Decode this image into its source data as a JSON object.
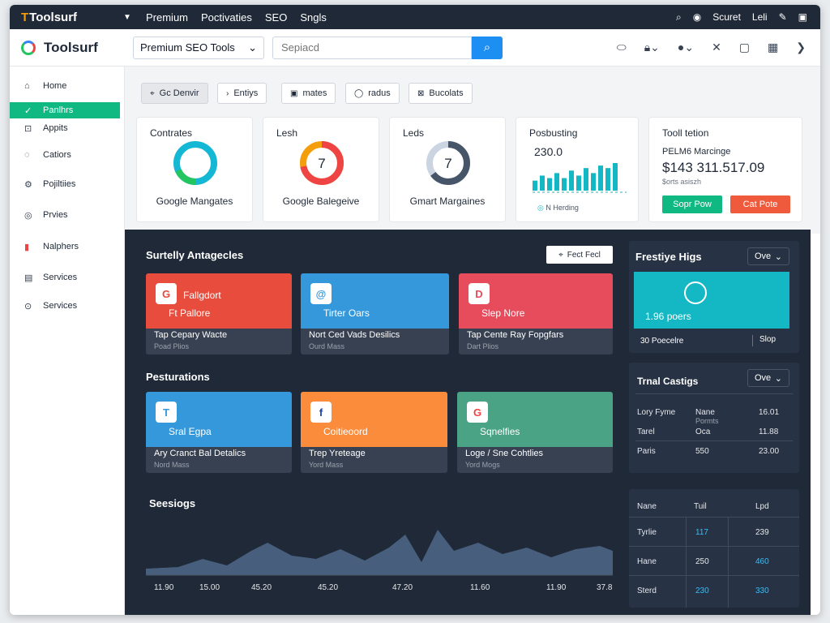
{
  "menubar": {
    "brand": "Toolsurf",
    "items": [
      "Premium",
      "Poctivaties",
      "SEO",
      "Sngls"
    ],
    "right_text": "Scuret",
    "right_text2": "Leli"
  },
  "toolbar": {
    "logo": "Toolsurf",
    "select_value": "Premium SEO Tools",
    "search_placeholder": "Sepiacd"
  },
  "sidebar": {
    "items": [
      {
        "label": "Home",
        "icon": "home-icon"
      },
      {
        "label": "Panlhrs",
        "icon": "check-icon",
        "active": true
      },
      {
        "label": "Appits",
        "icon": "apps-icon"
      },
      {
        "label": "Catiors",
        "icon": "location-icon"
      },
      {
        "label": "Pojiltiies",
        "icon": "gear-icon"
      },
      {
        "label": "Prvies",
        "icon": "target-icon"
      },
      {
        "label": "Nalphers",
        "icon": "chart-icon"
      },
      {
        "label": "Services",
        "icon": "list-icon"
      },
      {
        "label": "Services",
        "icon": "circle-icon"
      }
    ]
  },
  "chips": [
    {
      "label": "Gc Denvir",
      "icon": "pin-icon"
    },
    {
      "label": "Entiys",
      "icon": "chevron-icon"
    },
    {
      "label": "mates",
      "icon": "box-icon"
    },
    {
      "label": "radus",
      "icon": "shield-icon"
    },
    {
      "label": "Bucolats",
      "icon": "doc-icon"
    }
  ],
  "cards": {
    "c1": {
      "title": "Contrates",
      "bottom": "Google Mangates",
      "value": 1.0
    },
    "c2": {
      "title": "Lesh",
      "number": "7",
      "bottom": "Google Balegeive",
      "value": 0.72
    },
    "c3": {
      "title": "Leds",
      "number": "7",
      "bottom": "Gmart Margaines",
      "value": 0.65
    },
    "c4": {
      "title": "Posbusting",
      "value": "230.0",
      "legend": "N Herding",
      "bars": [
        4,
        6,
        5,
        7,
        5,
        8,
        6,
        9,
        7,
        10,
        9,
        11
      ]
    },
    "c5": {
      "title": "Tooll tetion",
      "sub": "PELM6 Marcinge",
      "price": "$143 311.517.09",
      "small": "$orts asiszh",
      "btn1": "Sopr Pow",
      "btn2": "Cat Pote"
    }
  },
  "dark": {
    "section1": "Surtelly Antagecles",
    "feed_btn": "Fect Fecl",
    "section2": "Pesturations",
    "section3": "Seesiogs",
    "tiles_row1": [
      {
        "label": "Fallgdort",
        "sub_label": "Ft Pallore",
        "t1": "Tap Cepary Wacte",
        "t2": "Poad Plios",
        "color": "#e74c3c",
        "icon": "G"
      },
      {
        "label": "Tirter Oars",
        "t1": "Nort Ced Vads Desilics",
        "t2": "Ourd Mass",
        "color": "#3498db",
        "icon": "@"
      },
      {
        "label": "Slep Nore",
        "t1": "Tap Cente Ray Fopgfars",
        "t2": "Dart Plios",
        "color": "#e74c5c",
        "icon": "D"
      }
    ],
    "tiles_row2": [
      {
        "label": "Sral Egpa",
        "t1": "Ary Cranct Bal Detalics",
        "t2": "Nord Mass",
        "color": "#3498db",
        "icon": "T"
      },
      {
        "label": "Coitieoord",
        "t1": "Trep Yreteage",
        "t2": "Yord Mass",
        "color": "#fb8c3c",
        "icon": "f"
      },
      {
        "label": "Sqnelfies",
        "t1": "Loge / Sne Cohtlies",
        "t2": "Yord Mogs",
        "color": "#4aa384",
        "icon": "G"
      }
    ],
    "right1": {
      "title": "Frestiye Higs",
      "dd": "Ove",
      "big": "1.96 poers",
      "foot_l": "30 Poecelre",
      "foot_r": "Slop"
    },
    "right2": {
      "title": "Trnal Castigs",
      "dd": "Ove",
      "rows": [
        [
          "Lory Fyme",
          "Nane",
          "16.01"
        ],
        [
          "Tarel",
          "Oca",
          "11.88"
        ],
        [
          "Paris",
          "550",
          "23.00"
        ]
      ],
      "subnote": "Pormts"
    },
    "right3": {
      "headers": [
        "Nane",
        "Tuil",
        "Lpd"
      ],
      "rows": [
        [
          "Tyrlie",
          "117",
          "239"
        ],
        [
          "Hane",
          "250",
          "460"
        ],
        [
          "Sterd",
          "230",
          "330"
        ]
      ]
    },
    "xaxis": [
      "11.90",
      "15.00",
      "45.20",
      "45.20",
      "47.20",
      "11.60",
      "11.90",
      "37.8"
    ]
  },
  "colors": {
    "accent": "#1d8ff2",
    "active": "#10b981",
    "dark": "#1f2937",
    "teal": "#14b8c4"
  }
}
